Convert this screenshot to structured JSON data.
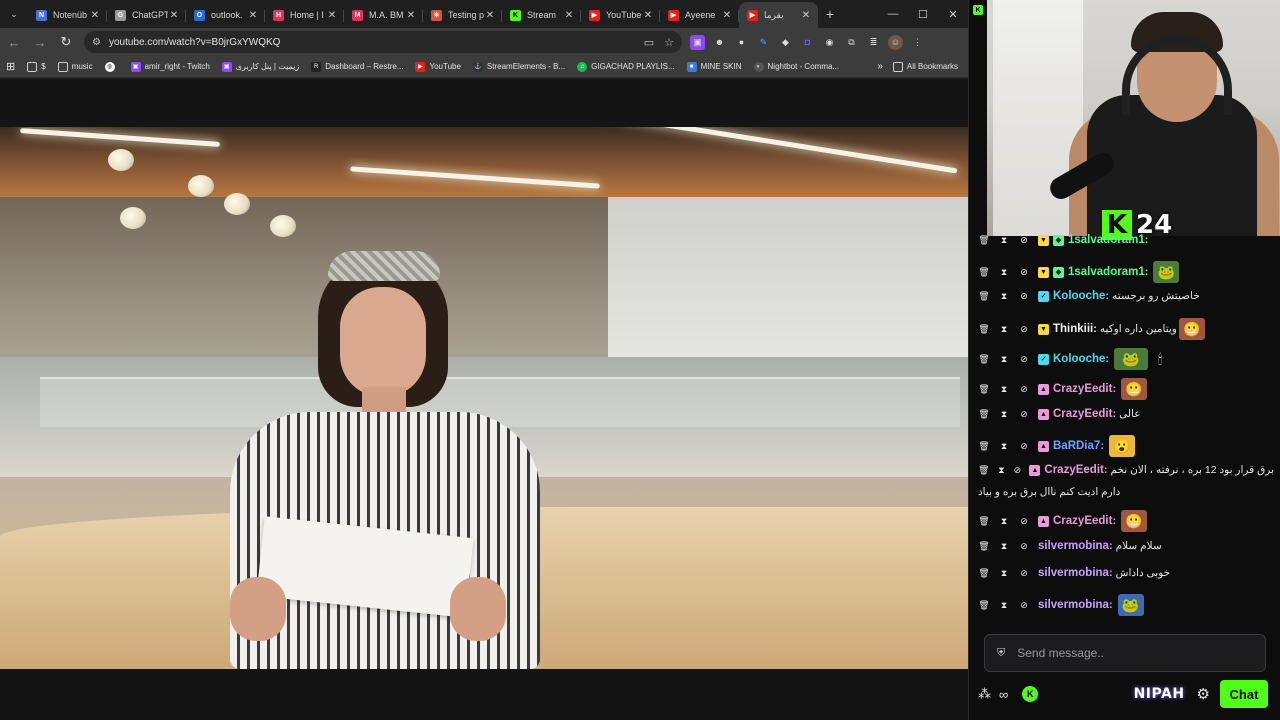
{
  "browser": {
    "tabs": [
      {
        "title": "Notenüb",
        "favicon": "N",
        "color": "#4a6fe0"
      },
      {
        "title": "ChatGPT",
        "favicon": "G",
        "color": "#9a9a9a"
      },
      {
        "title": "outlook.",
        "favicon": "O",
        "color": "#1f6fd6"
      },
      {
        "title": "Home | I",
        "favicon": "H",
        "color": "#d9345b"
      },
      {
        "title": "M.A. BM",
        "favicon": "M",
        "color": "#d9345b"
      },
      {
        "title": "Testing p",
        "favicon": "✳",
        "color": "#d9533a"
      },
      {
        "title": "Stream",
        "favicon": "K",
        "color": "#53fc18"
      },
      {
        "title": "YouTube",
        "favicon": "▶",
        "color": "#e62117"
      },
      {
        "title": "Ayeene",
        "favicon": "▶",
        "color": "#e62117"
      },
      {
        "title": "بقرما",
        "favicon": "▶",
        "color": "#e62117",
        "active": true
      }
    ],
    "new_tab": "+",
    "window_controls": {
      "minimize": "—",
      "maximize": "☐",
      "close": "✕"
    },
    "url": "youtube.com/watch?v=B0jrGxYWQKQ",
    "bookmarks": [
      {
        "label": "$",
        "icon": "folder"
      },
      {
        "label": "music",
        "icon": "folder"
      },
      {
        "label": "",
        "icon": "globe"
      },
      {
        "label": "amir_right - Twitch",
        "icon": "twitch"
      },
      {
        "label": "زیمیت | پنل کاربری",
        "icon": "twitch"
      },
      {
        "label": "Dashboard – Restre...",
        "icon": "restream"
      },
      {
        "label": "YouTube",
        "icon": "youtube"
      },
      {
        "label": "StreamElements - B...",
        "icon": "streamelements"
      },
      {
        "label": "GIGACHAD PLAYLIS...",
        "icon": "spotify"
      },
      {
        "label": "MINE SKIN",
        "icon": "mineskin"
      },
      {
        "label": "Nightbot - Comma...",
        "icon": "nightbot"
      }
    ],
    "bookmarks_more": "»",
    "all_bookmarks": "All Bookmarks"
  },
  "overlay": {
    "kick_logo": "K",
    "count": "24"
  },
  "chat": {
    "messages": [
      {
        "user": "1salvadoram1",
        "color": "#53fc90",
        "badges": [
          "sub",
          "vip"
        ],
        "text": "",
        "emote": ""
      },
      {
        "user": "1salvadoram1",
        "color": "#53fc90",
        "badges": [
          "sub",
          "vip"
        ],
        "text": "",
        "emote": "pepe"
      },
      {
        "user": "Kolooche",
        "color": "#4fd8f0",
        "badges": [
          "verified"
        ],
        "text": "خاصیتش رو برجسته",
        "emote": ""
      },
      {
        "user": "Thinkiii",
        "color": "#f0f0f0",
        "badges": [
          "sub"
        ],
        "text": "ویتامین داره اوکیه",
        "emote": "face"
      },
      {
        "user": "Kolooche",
        "color": "#4fd8f0",
        "badges": [
          "verified"
        ],
        "text": "",
        "emote": "pepe-sit"
      },
      {
        "user": "CrazyEedit",
        "color": "#e79bd8",
        "badges": [
          "og"
        ],
        "text": "",
        "emote": "face"
      },
      {
        "user": "CrazyEedit",
        "color": "#e79bd8",
        "badges": [
          "og"
        ],
        "text": "عالی",
        "emote": ""
      },
      {
        "user": "BaRDia7",
        "color": "#6aa6ff",
        "badges": [
          "og"
        ],
        "text": "",
        "emote": "blob"
      },
      {
        "user": "CrazyEedit",
        "color": "#e79bd8",
        "badges": [
          "og"
        ],
        "text": "برق قرار بود 12 بره ، نرفته ، الان نخم",
        "emote": ""
      },
      {
        "user": "CrazyEedit",
        "color": "#e79bd8",
        "badges": [
          "og"
        ],
        "text": "",
        "emote": "face"
      },
      {
        "user": "silvermobina",
        "color": "#c9a0ff",
        "badges": [],
        "text": "سلام سلام",
        "emote": ""
      },
      {
        "user": "silvermobina",
        "color": "#c9a0ff",
        "badges": [],
        "text": "خوبی داداش",
        "emote": ""
      },
      {
        "user": "silvermobina",
        "color": "#c9a0ff",
        "badges": [],
        "text": "",
        "emote": "pepe-small"
      }
    ],
    "wrap_continuation": "دارم ادیت کنم ناال برق بره و بیاد",
    "input_placeholder": "Send message..",
    "brand": "NIPAH",
    "chat_button": "Chat"
  },
  "colors": {
    "kick_green": "#53fc18",
    "chrome_dark": "#1f1f1f",
    "chrome_toolbar": "#3c3c3c",
    "chat_bg": "#0d0d0e"
  }
}
